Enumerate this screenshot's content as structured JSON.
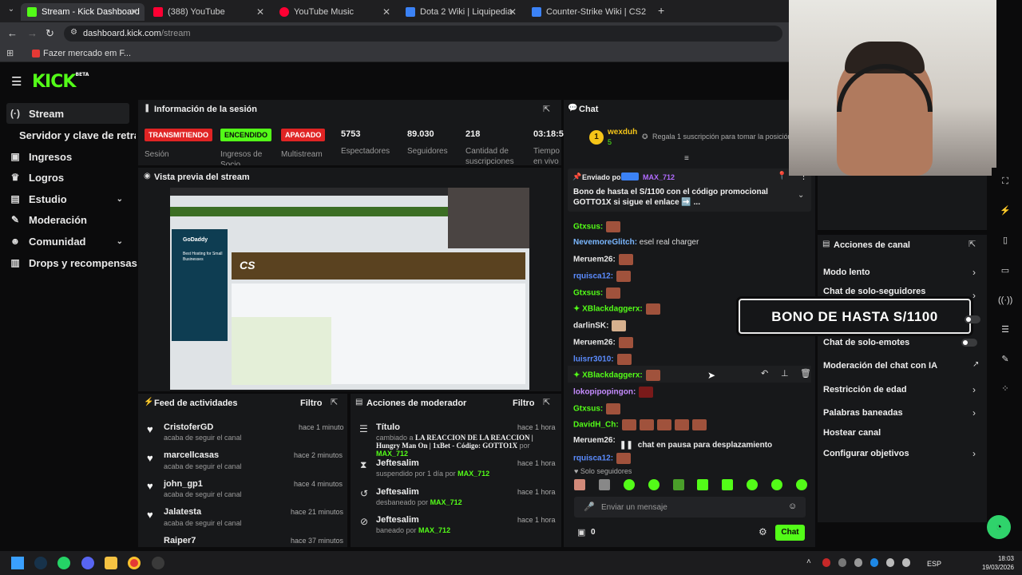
{
  "browser": {
    "tabs": [
      {
        "label": "Stream - Kick Dashboard",
        "color": "#53fc18"
      },
      {
        "label": "(388) YouTube",
        "color": "#ff0033"
      },
      {
        "label": "YouTube Music",
        "color": "#ff0033"
      },
      {
        "label": "Dota 2 Wiki | Liquipedia",
        "color": "#3b82f6"
      },
      {
        "label": "Counter-Strike Wiki | CS2 | Liqu",
        "color": "#3b82f6"
      }
    ],
    "url_host": "dashboard.kick.com",
    "url_path": "/stream",
    "bookmark": "Fazer mercado em F..."
  },
  "kick": {
    "logo": "KICK",
    "logo_tag": "BETA"
  },
  "sidebar": {
    "items": [
      {
        "label": "Stream",
        "icon": "signal-icon"
      },
      {
        "label": "Servidor y clave de retransm",
        "icon": ""
      },
      {
        "label": "Ingresos",
        "icon": "money-icon"
      },
      {
        "label": "Logros",
        "icon": "trophy-icon"
      },
      {
        "label": "Estudio",
        "icon": "studio-icon"
      },
      {
        "label": "Moderación",
        "icon": "wrench-icon"
      },
      {
        "label": "Comunidad",
        "icon": "people-icon"
      },
      {
        "label": "Drops y recompensas",
        "icon": "gift-icon"
      }
    ]
  },
  "session": {
    "title": "Información de la sesión",
    "badges": [
      {
        "text": "TRANSMITIENDO",
        "label": "Sesión"
      },
      {
        "text": "ENCENDIDO",
        "label": "Ingresos de Socio"
      },
      {
        "text": "APAGADO",
        "label": "Multistream"
      }
    ],
    "stats": [
      {
        "value": "5753",
        "label": "Espectadores"
      },
      {
        "value": "89.030",
        "label": "Seguidores"
      },
      {
        "value": "218",
        "label": "Cantidad de suscripciones"
      },
      {
        "value": "03:18:5",
        "label": "Tiempo en vivo"
      }
    ]
  },
  "preview": {
    "title": "Vista previa del stream",
    "site_name": "GoDaddy",
    "ad_text": "Best Hosting for Small Businesses",
    "banner": "CS"
  },
  "feed": {
    "title": "Feed de actividades",
    "filter": "Filtro",
    "items": [
      {
        "name": "CristoferGD",
        "sub": "acaba de seguir el canal",
        "time": "hace 1 minuto"
      },
      {
        "name": "marcellcasas",
        "sub": "acaba de seguir el canal",
        "time": "hace 2 minutos"
      },
      {
        "name": "john_gp1",
        "sub": "acaba de seguir el canal",
        "time": "hace 4 minutos"
      },
      {
        "name": "Jalatesta",
        "sub": "acaba de seguir el canal",
        "time": "hace 21 minutos"
      },
      {
        "name": "Raiper7",
        "sub": "",
        "time": "hace 37 minutos"
      }
    ]
  },
  "mod": {
    "title": "Acciones de moderador",
    "filter": "Filtro",
    "items": [
      {
        "name": "Título",
        "sub_a": "cambiado a ",
        "sub_bold": "LA REACCION DE LA REACCION | Hungry Man On | 1xBet - Código: GOTTO1X",
        "sub_b": " por ",
        "by": "MAX_712",
        "time": "hace 1 hora"
      },
      {
        "name": "Jeftesalim",
        "sub_a": "suspendido por 1 día por ",
        "sub_bold": "",
        "sub_b": "",
        "by": "MAX_712",
        "time": "hace 1 hora"
      },
      {
        "name": "Jeftesalim",
        "sub_a": "desbaneado por ",
        "sub_bold": "",
        "sub_b": "",
        "by": "MAX_712",
        "time": "hace 1 hora"
      },
      {
        "name": "Jeftesalim",
        "sub_a": "baneado por ",
        "sub_bold": "",
        "sub_b": "",
        "by": "MAX_712",
        "time": "hace 1 hora"
      }
    ]
  },
  "chat": {
    "title": "Chat",
    "top_user": "wexduh",
    "top_rank": "1",
    "top_count": "5",
    "gift_text": "Regala 1 suscripción para tomar la posición 2",
    "pinned_label": "Enviado por",
    "pinned_by": "MAX_712",
    "pinned_text": "Bono de hasta el S/1100 con el código promocional GOTTO1X si sigue el enlace ➡️ ...",
    "messages": [
      {
        "user": "Gtxsus:",
        "color": "#53fc18",
        "text": ""
      },
      {
        "user": "NevemoreGlitch:",
        "color": "#7ab7ff",
        "text": " esel real charger"
      },
      {
        "user": "Meruem26:",
        "color": "#e9e9e9",
        "text": ""
      },
      {
        "user": "rquisca12:",
        "color": "#5b8cff",
        "text": ""
      },
      {
        "user": "Gtxsus:",
        "color": "#53fc18",
        "text": ""
      },
      {
        "user": "XBlackdaggerx:",
        "color": "#53fc18",
        "text": ""
      },
      {
        "user": "darlinSK:",
        "color": "#e9e9e9",
        "text": ""
      },
      {
        "user": "Meruem26:",
        "color": "#e9e9e9",
        "text": ""
      },
      {
        "user": "luisrr3010:",
        "color": "#5b8cff",
        "text": ""
      },
      {
        "user": "XBlackdaggerx:",
        "color": "#53fc18",
        "text": ""
      },
      {
        "user": "lokopipopingon:",
        "color": "#c58cff",
        "text": ""
      },
      {
        "user": "Gtxsus:",
        "color": "#53fc18",
        "text": ""
      },
      {
        "user": "DavidH_Ch:",
        "color": "#53fc18",
        "text": ""
      },
      {
        "user": "Meruem26:",
        "color": "#e9e9e9",
        "text": ""
      },
      {
        "user": "rquisca12:",
        "color": "#5b8cff",
        "text": ""
      }
    ],
    "paused": "chat en pausa para desplazamiento",
    "followers_only": "Solo seguidores",
    "input_placeholder": "Enviar un mensaje",
    "points": "0",
    "send": "Chat"
  },
  "channel_actions": {
    "title": "Acciones de canal",
    "items": [
      {
        "label": "Modo lento",
        "type": "chevron"
      },
      {
        "label": "Chat de solo-seguidores",
        "type": "chevron"
      },
      {
        "label": "Chat de solo-emotes",
        "type": "toggle"
      },
      {
        "label": "Moderación del chat con IA",
        "type": "external"
      },
      {
        "label": "Restricción de edad",
        "type": "chevron"
      },
      {
        "label": "Palabras baneadas",
        "type": "chevron"
      },
      {
        "label": "Hostear canal",
        "type": "none"
      },
      {
        "label": "Configurar objetivos",
        "type": "chevron"
      }
    ]
  },
  "overlay": {
    "bono_banner": "BONO DE HASTA S/1100"
  },
  "taskbar": {
    "lang": "ESP",
    "time": "18:03",
    "date": "19/03/2026"
  }
}
